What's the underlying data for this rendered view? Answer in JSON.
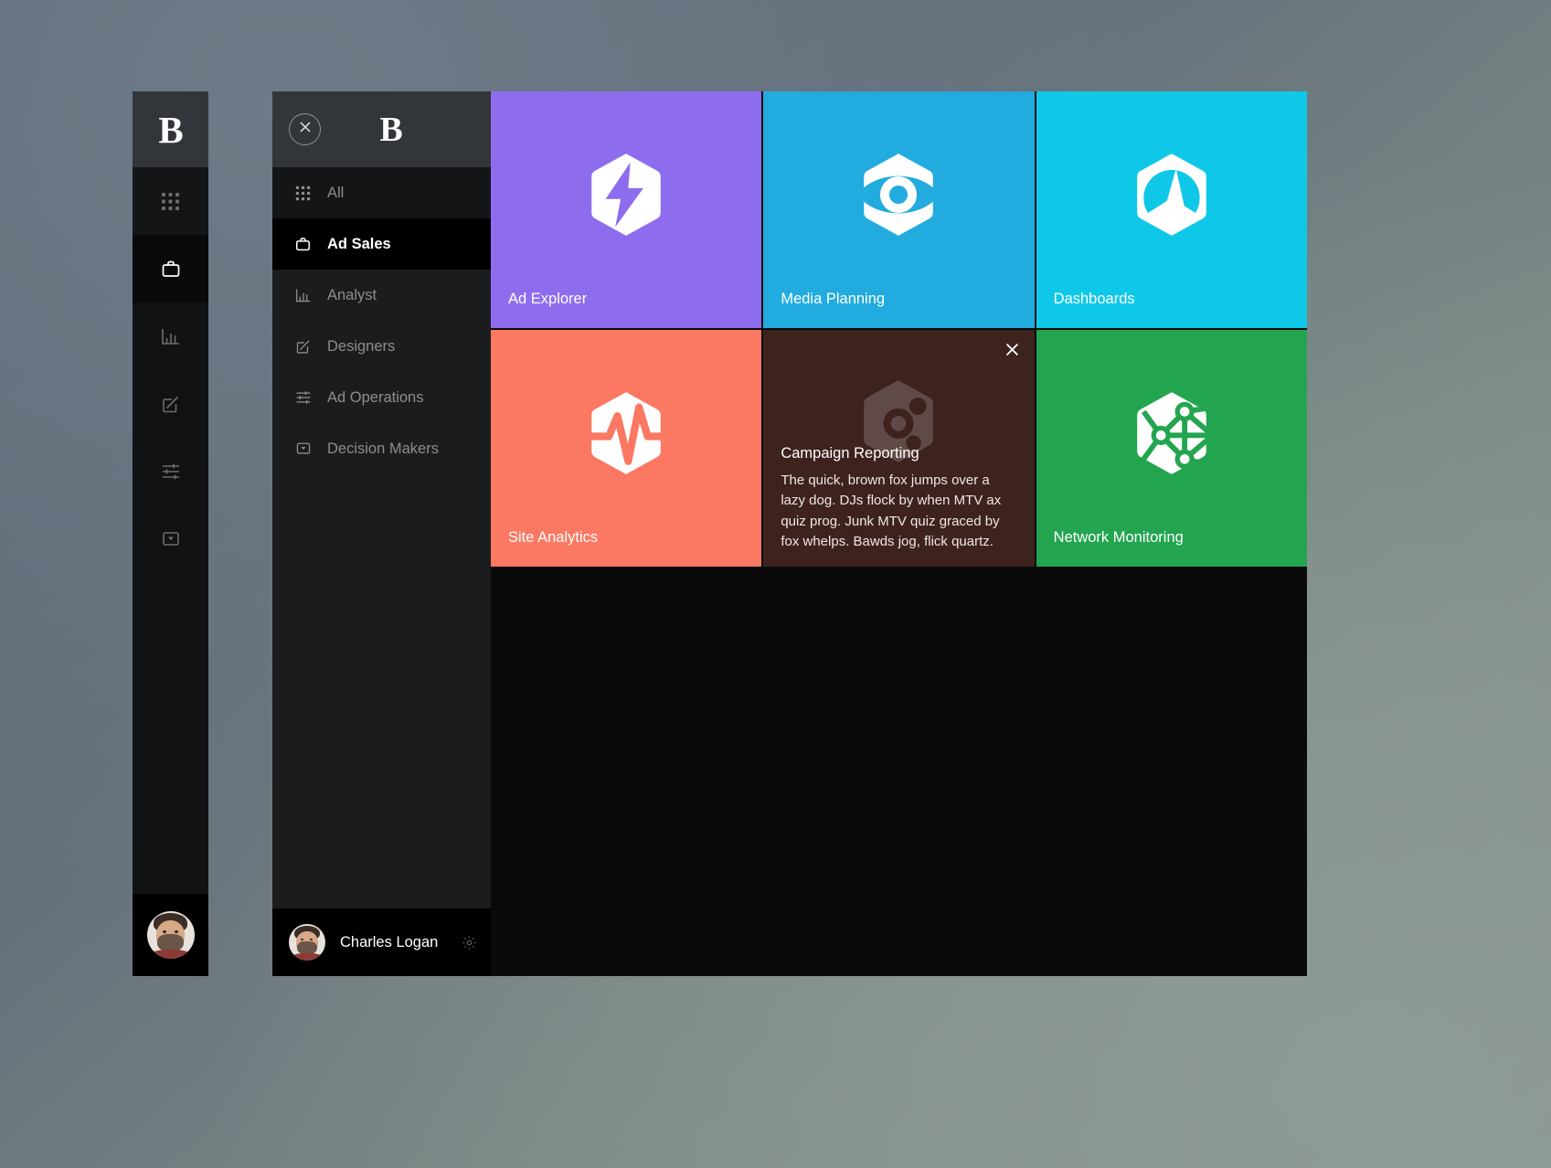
{
  "brand": {
    "logo_letter": "B"
  },
  "rail": {
    "items": [
      {
        "name": "apps-grid-icon",
        "label": "Apps"
      },
      {
        "name": "briefcase-icon",
        "label": "Ad Sales"
      },
      {
        "name": "bar-chart-icon",
        "label": "Analyst"
      },
      {
        "name": "pencil-square-icon",
        "label": "Designers"
      },
      {
        "name": "sliders-icon",
        "label": "Ad Operations"
      },
      {
        "name": "inbox-icon",
        "label": "Decision Makers"
      }
    ]
  },
  "panel": {
    "close_label": "Close",
    "nav": [
      {
        "label": "All",
        "icon": "apps-grid-icon",
        "active": false
      },
      {
        "label": "Ad Sales",
        "icon": "briefcase-icon",
        "active": true
      },
      {
        "label": "Analyst",
        "icon": "bar-chart-icon",
        "active": false
      },
      {
        "label": "Designers",
        "icon": "pencil-square-icon",
        "active": false
      },
      {
        "label": "Ad Operations",
        "icon": "sliders-icon",
        "active": false
      },
      {
        "label": "Decision Makers",
        "icon": "inbox-icon",
        "active": false
      }
    ],
    "user": {
      "name": "Charles Logan",
      "settings_icon": "gear-icon"
    }
  },
  "tiles": [
    {
      "label": "Ad Explorer",
      "color": "#8E6CEE",
      "icon": "hex-lightning-icon"
    },
    {
      "label": "Media Planning",
      "color": "#22ABDF",
      "icon": "hex-eye-icon"
    },
    {
      "label": "Dashboards",
      "color": "#0FC8E8",
      "icon": "hex-gauge-icon"
    },
    {
      "label": "Site Analytics",
      "color": "#FB7862",
      "icon": "hex-pulse-icon"
    },
    {
      "label": "Campaign Reporting",
      "color": "#3D221E",
      "icon": "hex-bug-icon",
      "hovered": true,
      "description": "The quick, brown fox jumps over a lazy dog. DJs flock by when MTV ax quiz prog. Junk MTV quiz graced by fox whelps. Bawds jog, flick quartz.",
      "close_label": "Close"
    },
    {
      "label": "Network Monitoring",
      "color": "#23A550",
      "icon": "hex-network-icon"
    }
  ]
}
